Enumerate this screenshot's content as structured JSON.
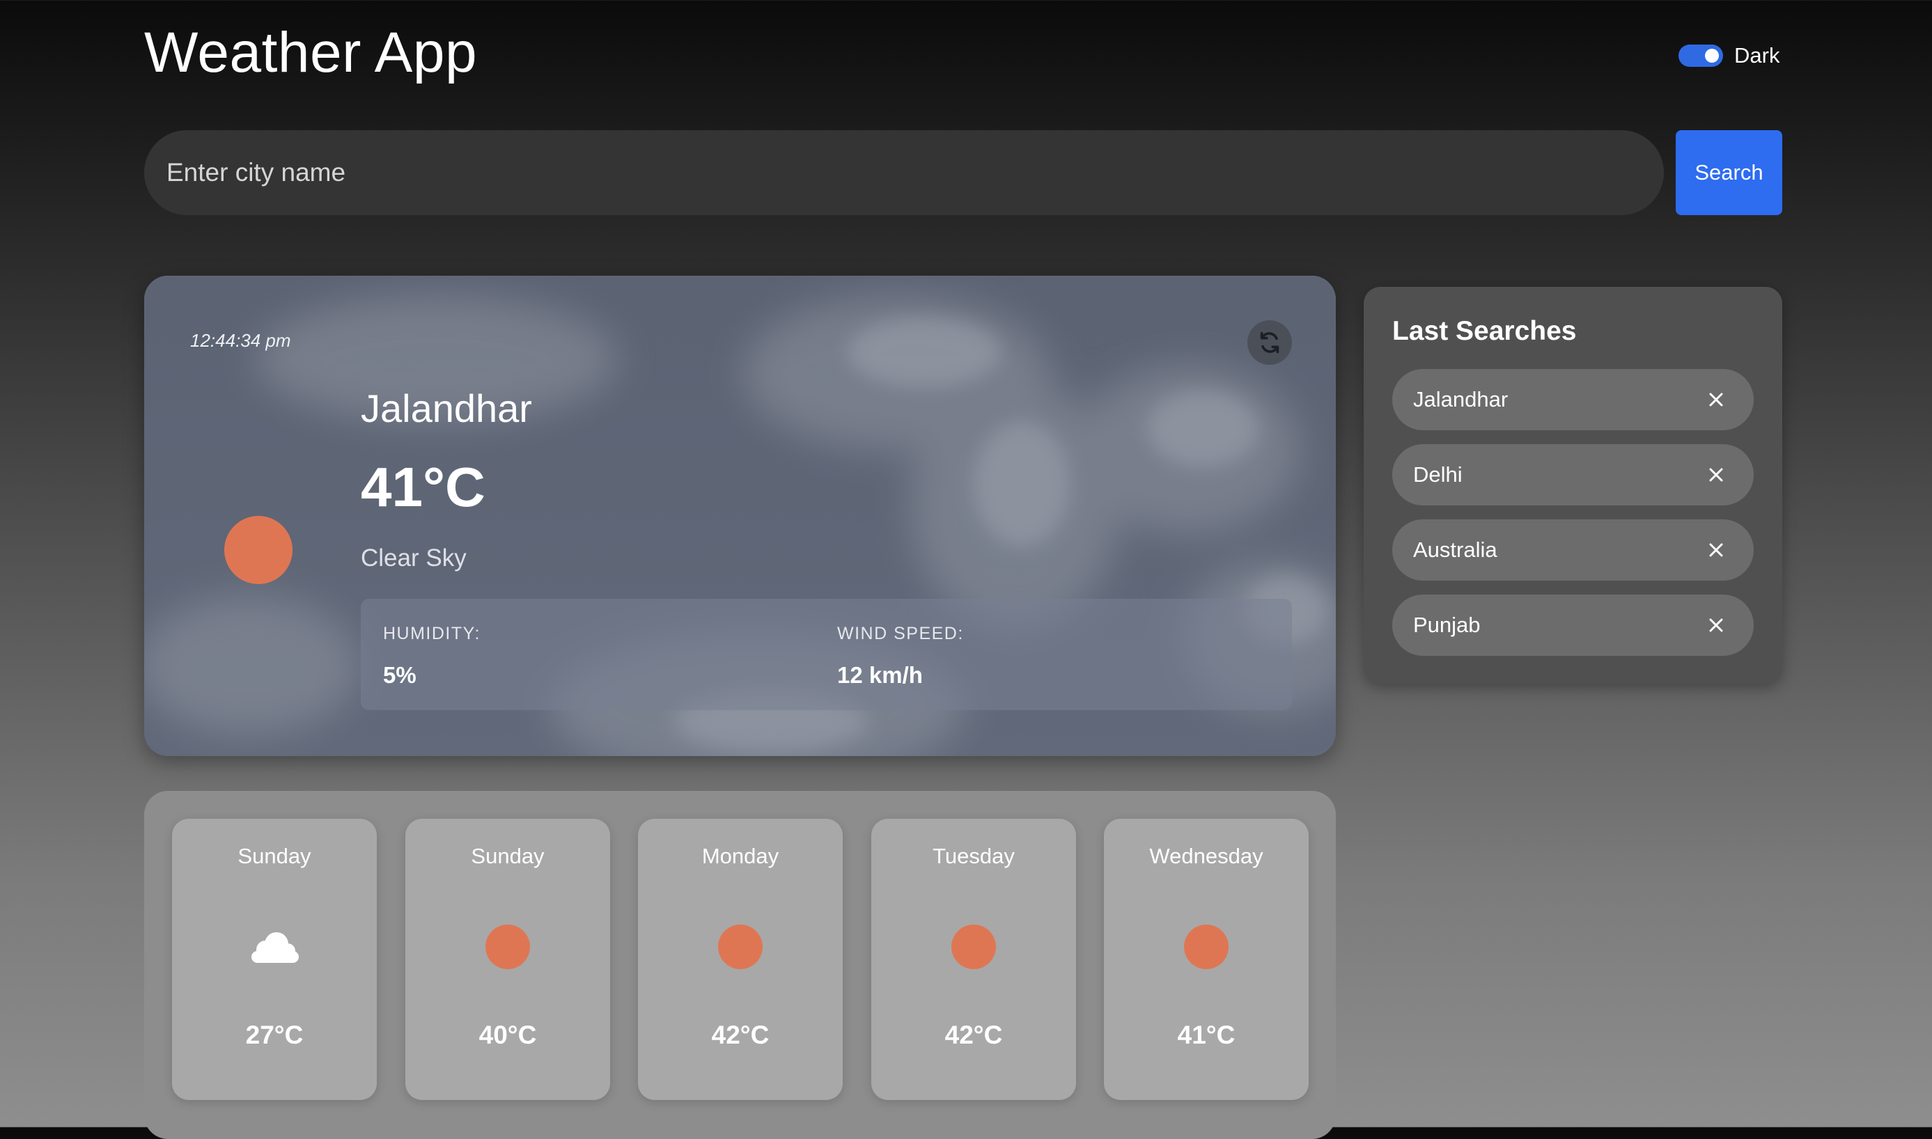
{
  "header": {
    "title": "Weather App",
    "theme_label": "Dark",
    "theme_dark_enabled": true
  },
  "search": {
    "placeholder": "Enter city name",
    "value": "",
    "button_label": "Search"
  },
  "current": {
    "time": "12:44:34 pm",
    "city": "Jalandhar",
    "temperature": "41°C",
    "condition": "Clear Sky",
    "icon": "sun-icon",
    "humidity_label": "HUMIDITY:",
    "humidity_value": "5%",
    "wind_label": "WIND SPEED:",
    "wind_value": "12 km/h",
    "refresh_icon": "refresh-icon"
  },
  "last_searches": {
    "title": "Last Searches",
    "items": [
      {
        "label": "Jalandhar"
      },
      {
        "label": "Delhi"
      },
      {
        "label": "Australia"
      },
      {
        "label": "Punjab"
      }
    ],
    "remove_icon": "close-icon"
  },
  "forecast": [
    {
      "day": "Sunday",
      "icon": "cloud-icon",
      "temp": "27°C"
    },
    {
      "day": "Sunday",
      "icon": "sun-icon",
      "temp": "40°C"
    },
    {
      "day": "Monday",
      "icon": "sun-icon",
      "temp": "42°C"
    },
    {
      "day": "Tuesday",
      "icon": "sun-icon",
      "temp": "42°C"
    },
    {
      "day": "Wednesday",
      "icon": "sun-icon",
      "temp": "41°C"
    }
  ],
  "colors": {
    "accent": "#2e6cf0",
    "sun": "#df7653"
  }
}
